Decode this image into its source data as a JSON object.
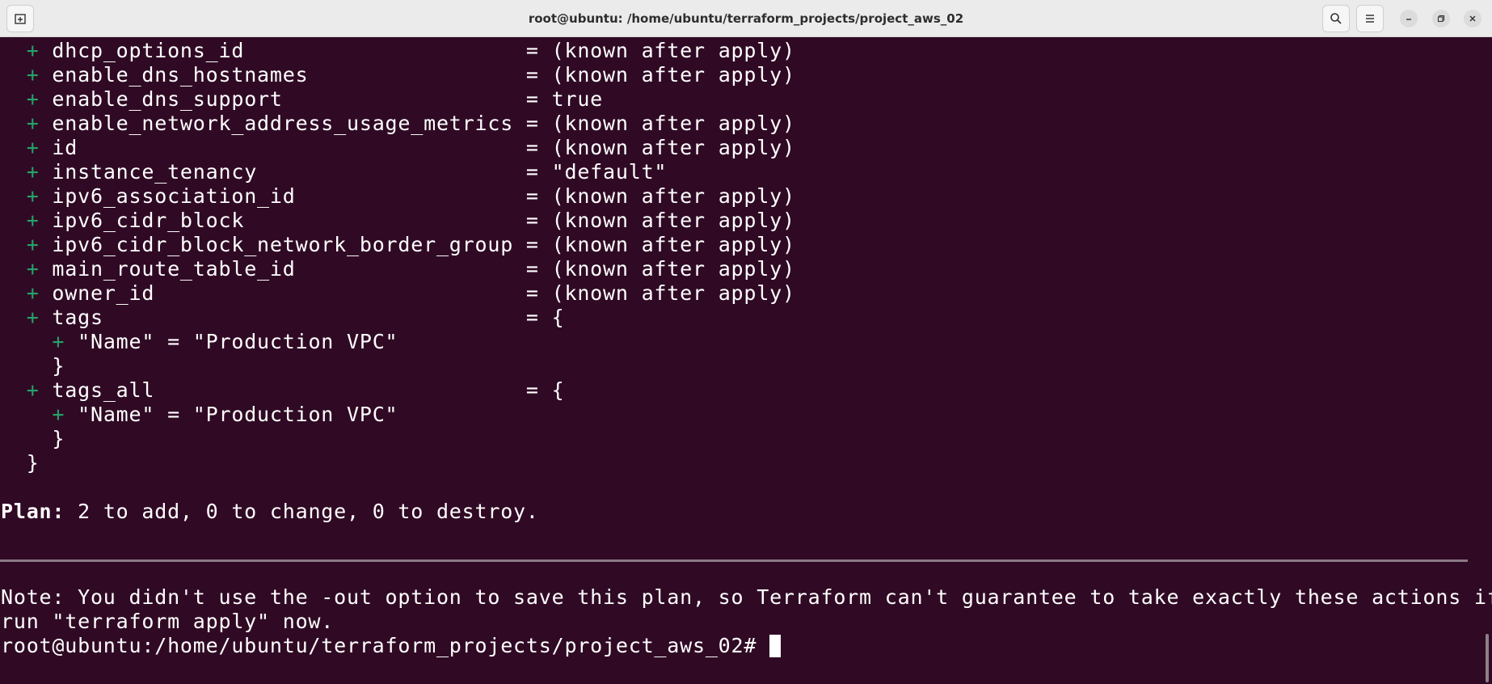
{
  "window": {
    "title": "root@ubuntu: /home/ubuntu/terraform_projects/project_aws_02",
    "icons": {
      "new_tab": "new-tab-icon",
      "search": "search-icon",
      "menu": "hamburger-menu-icon",
      "minimize": "minimize-icon",
      "maximize": "maximize-icon",
      "close": "close-icon"
    }
  },
  "terminal": {
    "attributes": [
      {
        "name": "dhcp_options_id                      ",
        "value": "= (known after apply)"
      },
      {
        "name": "enable_dns_hostnames                 ",
        "value": "= (known after apply)"
      },
      {
        "name": "enable_dns_support                   ",
        "value": "= true"
      },
      {
        "name": "enable_network_address_usage_metrics ",
        "value": "= (known after apply)"
      },
      {
        "name": "id                                   ",
        "value": "= (known after apply)"
      },
      {
        "name": "instance_tenancy                     ",
        "value": "= \"default\""
      },
      {
        "name": "ipv6_association_id                  ",
        "value": "= (known after apply)"
      },
      {
        "name": "ipv6_cidr_block                      ",
        "value": "= (known after apply)"
      },
      {
        "name": "ipv6_cidr_block_network_border_group ",
        "value": "= (known after apply)"
      },
      {
        "name": "main_route_table_id                  ",
        "value": "= (known after apply)"
      },
      {
        "name": "owner_id                             ",
        "value": "= (known after apply)"
      },
      {
        "name": "tags                                 ",
        "value": "= {"
      }
    ],
    "tags_entry": "\"Name\" = \"Production VPC\"",
    "close_brace_inner": "}",
    "tags_all_name": "tags_all                             ",
    "tags_all_value": "= {",
    "tags_all_entry": "\"Name\" = \"Production VPC\"",
    "close_brace_outer": "}",
    "plus_symbol": "+",
    "plan_label": "Plan:",
    "plan_text": " 2 to add, 0 to change, 0 to destroy.",
    "note_line1": "Note: You didn't use the -out option to save this plan, so Terraform can't guarantee to take exactly these actions if you",
    "note_line2": "run \"terraform apply\" now.",
    "prompt": "root@ubuntu:/home/ubuntu/terraform_projects/project_aws_02# "
  },
  "colors": {
    "background": "#300a24",
    "plus": "#26a269",
    "text": "#ffffff",
    "titlebar": "#ebebeb"
  }
}
